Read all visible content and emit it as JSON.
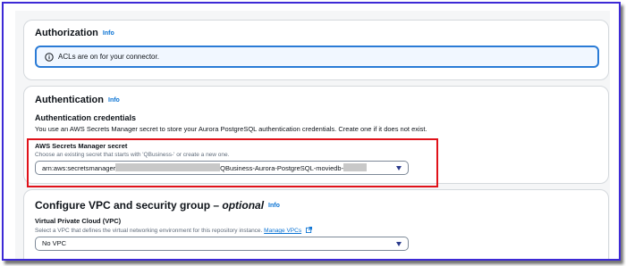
{
  "authorization": {
    "title": "Authorization",
    "info": "Info",
    "alert_text": "ACLs are on for your connector."
  },
  "authentication": {
    "title": "Authentication",
    "info": "Info",
    "subheading": "Authentication credentials",
    "description": "You use an AWS Secrets Manager secret to store your Aurora PostgreSQL authentication credentials. Create one if it does not exist.",
    "secret_label": "AWS Secrets Manager secret",
    "secret_hint": "Choose an existing secret that starts with 'QBusiness-' or create a new one.",
    "secret_value_prefix": "arn:aws:secretsmanager",
    "secret_value_middle": "QBusiness-Aurora-PostgreSQL-moviedb-"
  },
  "vpc": {
    "title_main": "Configure VPC and security group – ",
    "title_optional": "optional",
    "info": "Info",
    "vpc_label": "Virtual Private Cloud (VPC)",
    "vpc_hint": "Select a VPC that defines the virtual networking environment for this repository instance.",
    "manage_link": "Manage VPCs",
    "vpc_value": "No VPC"
  },
  "colors": {
    "frame": "#3d2ad6",
    "highlight": "#e0121a",
    "link": "#0972d3",
    "alert_border": "#2a7bd6"
  }
}
